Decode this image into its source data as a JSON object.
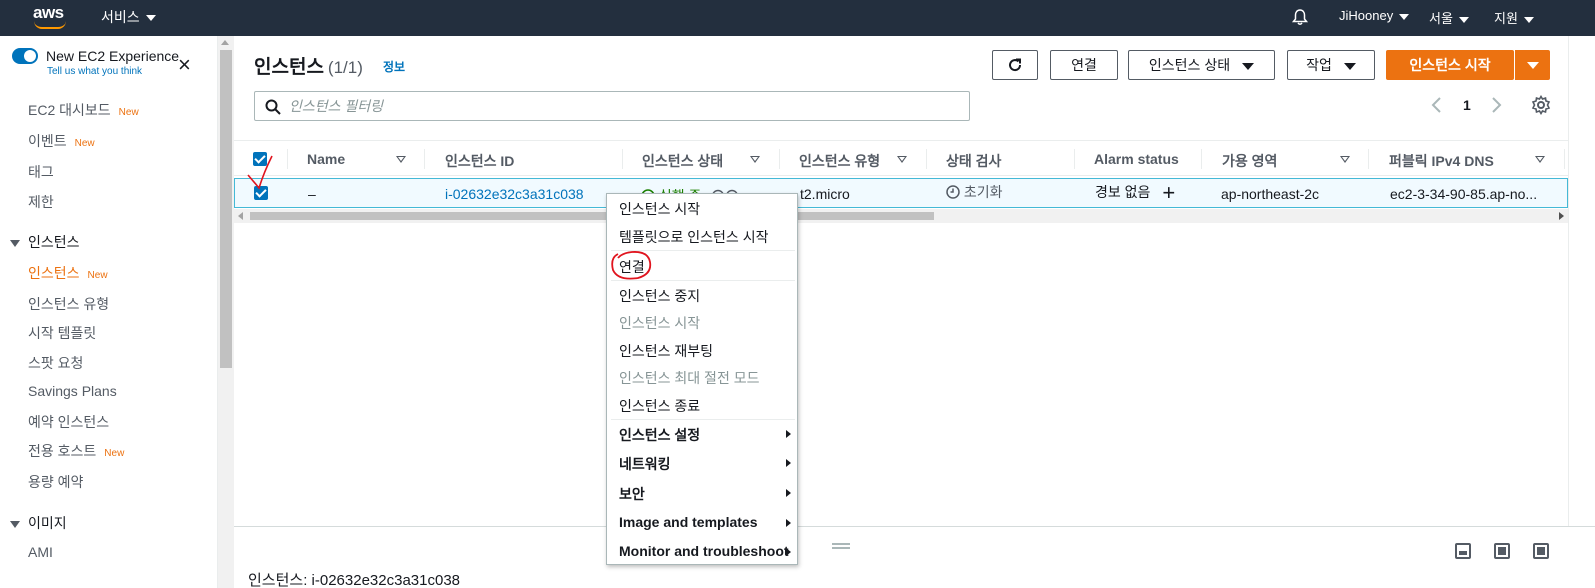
{
  "topnav": {
    "logo": "aws",
    "services": "서비스",
    "user": "JiHooney",
    "region": "서울",
    "support": "지원",
    "icons": [
      "bell-icon"
    ]
  },
  "sidebar": {
    "experience_title": "New EC2 Experience",
    "experience_sub": "Tell us what you think",
    "items": [
      {
        "label": "EC2 대시보드",
        "badge": "New"
      },
      {
        "label": "이벤트",
        "badge": "New"
      },
      {
        "label": "태그",
        "badge": ""
      },
      {
        "label": "제한",
        "badge": ""
      }
    ],
    "section_instances": "인스턴스",
    "instance_items": [
      {
        "label": "인스턴스",
        "badge": "New"
      },
      {
        "label": "인스턴스 유형",
        "badge": ""
      },
      {
        "label": "시작 템플릿",
        "badge": ""
      },
      {
        "label": "스팟 요청",
        "badge": ""
      },
      {
        "label": "Savings Plans",
        "badge": ""
      },
      {
        "label": "예약 인스턴스",
        "badge": ""
      },
      {
        "label": "전용 호스트",
        "badge": "New"
      },
      {
        "label": "용량 예약",
        "badge": ""
      }
    ],
    "section_images": "이미지",
    "image_items": [
      {
        "label": "AMI",
        "badge": ""
      }
    ]
  },
  "header": {
    "title": "인스턴스",
    "count": "(1/1)",
    "info": "정보",
    "connect": "연결",
    "state": "인스턴스 상태",
    "actions": "작업",
    "launch": "인스턴스 시작"
  },
  "search": {
    "placeholder": "인스턴스 필터링"
  },
  "pager": {
    "page": "1"
  },
  "table": {
    "columns": [
      "Name",
      "인스턴스 ID",
      "인스턴스 상태",
      "인스턴스 유형",
      "상태 검사",
      "Alarm status",
      "가용 영역",
      "퍼블릭 IPv4 DNS"
    ],
    "row": {
      "name": "–",
      "id": "i-02632e32c3a31c038",
      "state": "실행 중",
      "type": "t2.micro",
      "check": "초기화",
      "alarm": "경보 없음",
      "az": "ap-northeast-2c",
      "dns": "ec2-3-34-90-85.ap-no..."
    }
  },
  "bottom": {
    "title": "인스턴스: i-02632e32c3a31c038"
  },
  "context_menu": {
    "items": [
      {
        "label": "인스턴스 시작",
        "state": "enabled"
      },
      {
        "label": "템플릿으로 인스턴스 시작",
        "state": "enabled"
      },
      {
        "label": "연결",
        "state": "enabled"
      },
      {
        "label": "인스턴스 중지",
        "state": "enabled"
      },
      {
        "label": "인스턴스 시작",
        "state": "disabled"
      },
      {
        "label": "인스턴스 재부팅",
        "state": "enabled"
      },
      {
        "label": "인스턴스 최대 절전 모드",
        "state": "disabled"
      },
      {
        "label": "인스턴스 종료",
        "state": "enabled"
      },
      {
        "label": "인스턴스 설정",
        "state": "submenu"
      },
      {
        "label": "네트워킹",
        "state": "submenu"
      },
      {
        "label": "보안",
        "state": "submenu"
      },
      {
        "label": "Image and templates",
        "state": "submenu"
      },
      {
        "label": "Monitor and troubleshoot",
        "state": "submenu"
      }
    ]
  },
  "colors": {
    "nav_bg": "#232f3e",
    "accent_orange": "#ec7211",
    "link_blue": "#0073bb",
    "running_green": "#1d8102",
    "annotation_red": "#e0141e"
  }
}
